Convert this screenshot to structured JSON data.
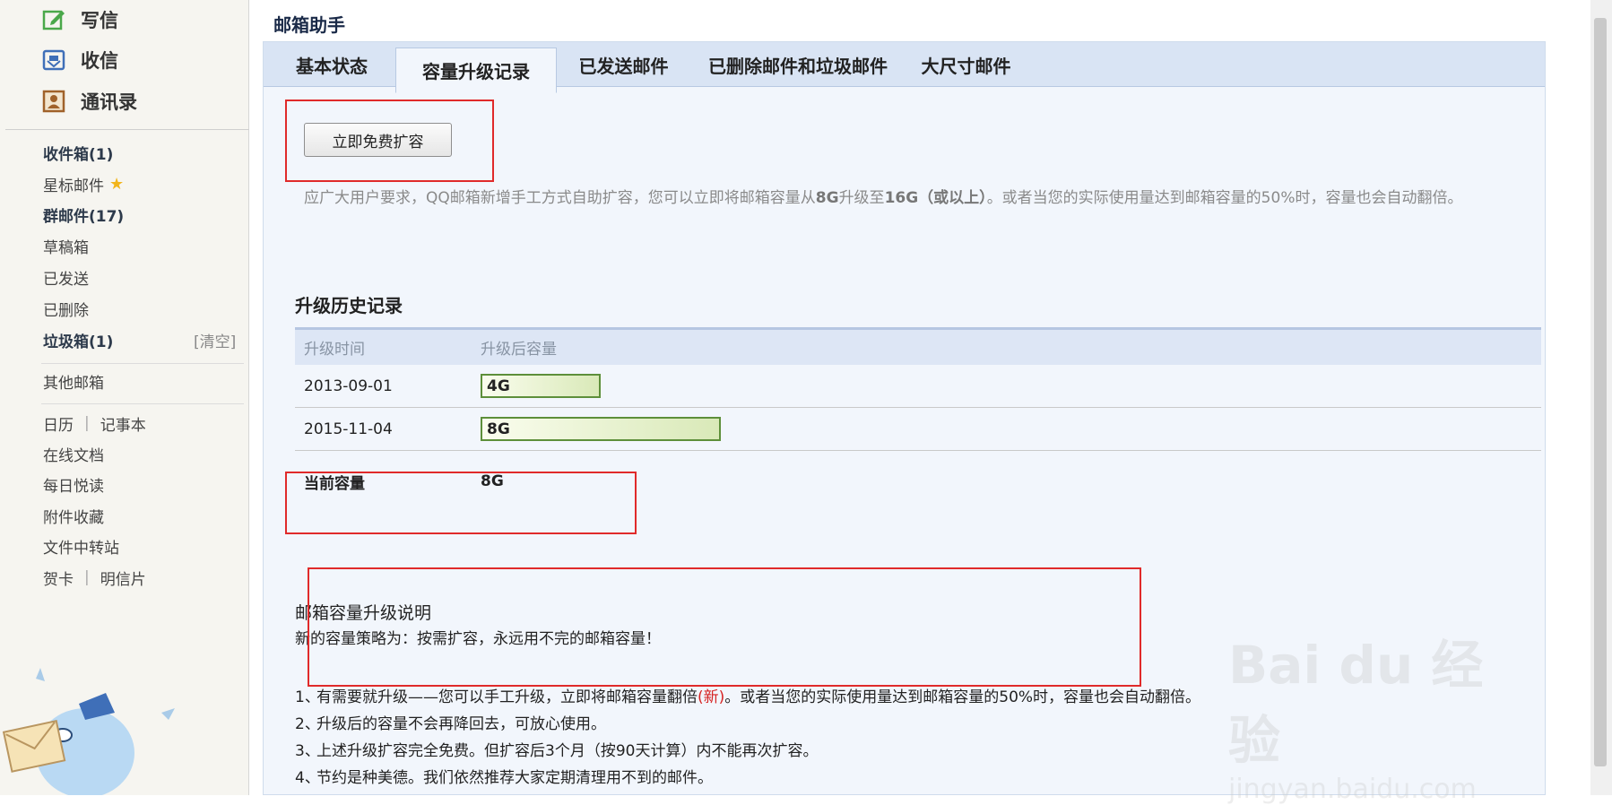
{
  "sidebar": {
    "top": [
      {
        "label": "写信",
        "icon": "compose-icon"
      },
      {
        "label": "收信",
        "icon": "inbox-tray-icon"
      },
      {
        "label": "通讯录",
        "icon": "contacts-icon"
      }
    ],
    "folders": [
      {
        "label": "收件箱(1)",
        "bold": true
      },
      {
        "label": "星标邮件",
        "star": "★"
      },
      {
        "label": "群邮件(17)",
        "bold": true
      },
      {
        "label": "草稿箱"
      },
      {
        "label": "已发送"
      },
      {
        "label": "已删除"
      },
      {
        "label": "垃圾箱(1)",
        "bold": true
      }
    ],
    "clear": "[清空]",
    "other": "其他邮箱",
    "tools": {
      "calendar": "日历",
      "notepad": "记事本",
      "docs": "在线文档",
      "daily": "每日悦读",
      "attachments": "附件收藏",
      "transfer": "文件中转站",
      "card": "贺卡",
      "postcard": "明信片",
      "pipe": "|"
    }
  },
  "main": {
    "title": "邮箱助手",
    "tabs": [
      "基本状态",
      "容量升级记录",
      "已发送邮件",
      "已删除邮件和垃圾邮件",
      "大尺寸邮件"
    ],
    "active_tab": 1,
    "expand_button": "立即免费扩容",
    "desc_part1": "应广大用户要求，QQ邮箱新增手工方式自助扩容，您可以立即将邮箱容量从",
    "desc_bold1": "8G",
    "desc_part2": "升级至",
    "desc_bold2": "16G（或以上）",
    "desc_part3": "。或者当您的实际使用量达到邮箱容量的50%时，容量也会自动翻倍。",
    "history_title": "升级历史记录",
    "table": {
      "headers": [
        "升级时间",
        "升级后容量"
      ],
      "rows": [
        {
          "date": "2013-09-01",
          "capacity": "4G",
          "fill": 0.5
        },
        {
          "date": "2015-11-04",
          "capacity": "8G",
          "fill": 1.0
        }
      ],
      "current_label": "当前容量",
      "current_value": "8G"
    },
    "note_title": "邮箱容量升级说明",
    "note_sub": "新的容量策略为：按需扩容，永远用不完的邮箱容量！",
    "rules": [
      {
        "num": "1、",
        "text_a": "有需要就升级——您可以手工升级，立即将邮箱容量翻倍",
        "red": "(新)",
        "text_b": "。或者当您的实际使用量达到邮箱容量的50%时，容量也会自动翻倍。"
      },
      {
        "num": "2、",
        "text_a": "升级后的容量不会再降回去，可放心使用。"
      },
      {
        "num": "3、",
        "text_a": "上述升级扩容完全免费。但扩容后3个月（按90天计算）内不能再次扩容。"
      },
      {
        "num": "4、",
        "text_a": "节约是种美德。我们依然推荐大家定期清理用不到的邮件。"
      }
    ]
  },
  "watermark": {
    "brand": "Bai du 经验",
    "url": "jingyan.baidu.com"
  },
  "colors": {
    "highlight_box": "#e02a2a",
    "bar_border": "#5d8f3a",
    "tab_bg": "#d9e4f4"
  }
}
